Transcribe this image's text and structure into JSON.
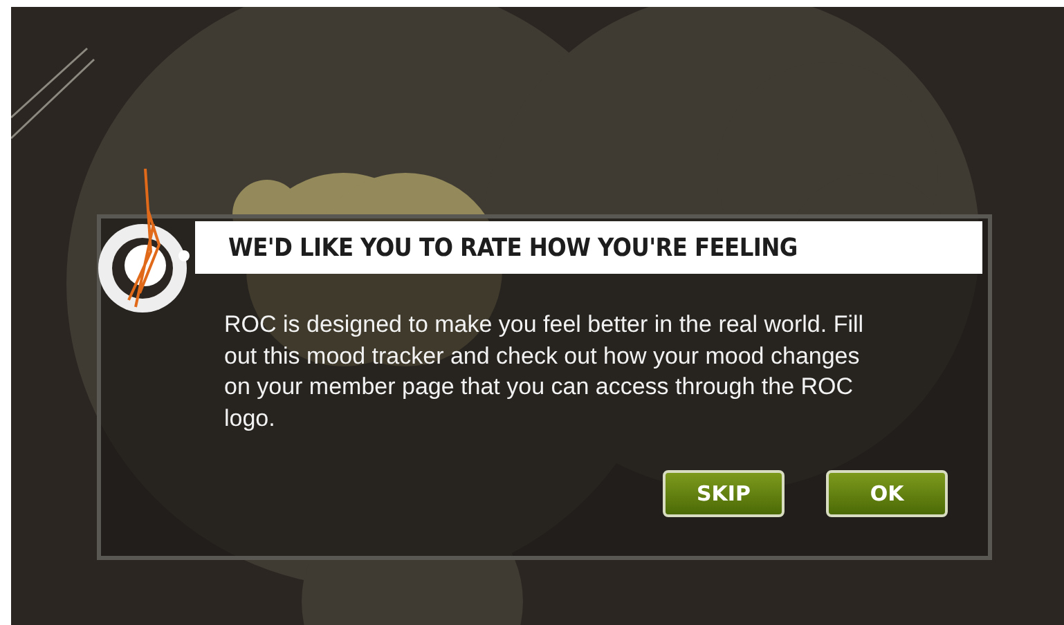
{
  "dialog": {
    "title": "WE'D LIKE YOU TO RATE HOW YOU'RE FEELING",
    "message": "ROC is designed to make you feel better in the real world. Fill out this mood tracker and check out how your mood changes on your member page that you can access through the ROC logo.",
    "buttons": [
      "SKIP",
      "OK"
    ]
  }
}
